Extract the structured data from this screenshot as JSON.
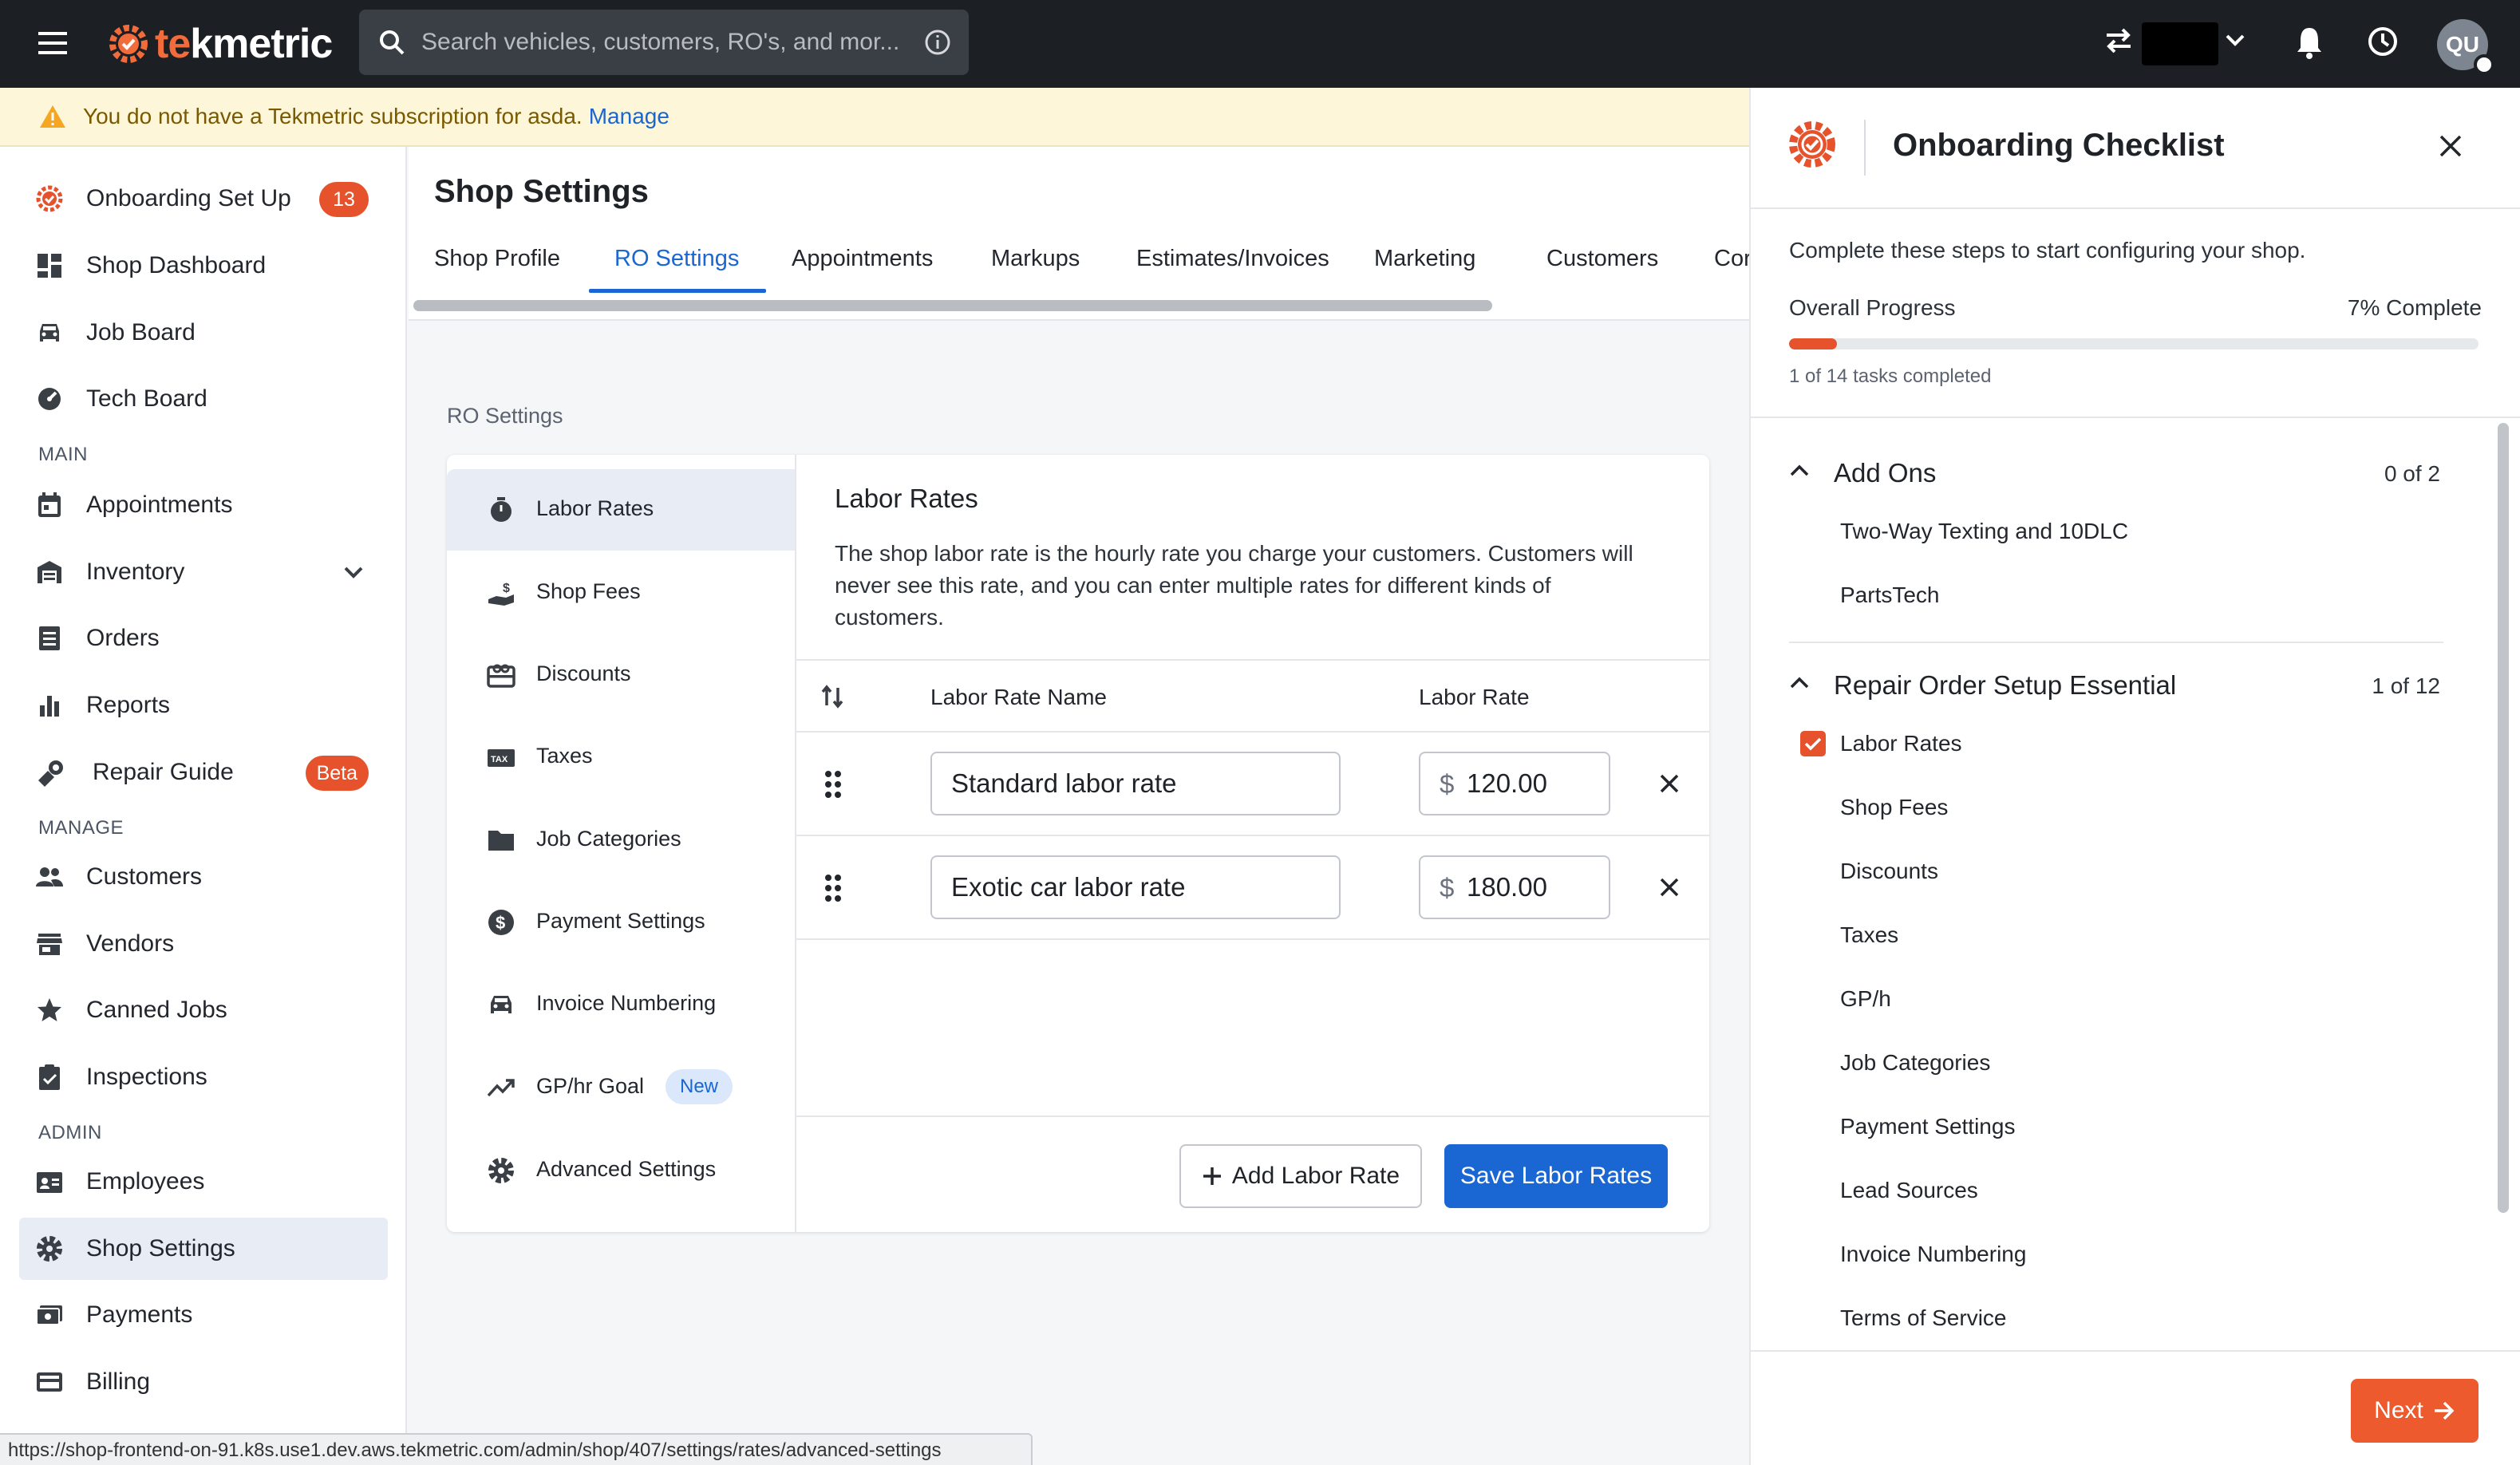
{
  "topbar": {
    "logo_text_accent": "te",
    "logo_text_rest": "kmetric",
    "search_placeholder": "Search vehicles, customers, RO's, and mor...",
    "avatar_initials": "QU",
    "icons": [
      "menu-icon",
      "search-icon",
      "info-icon",
      "swap-icon",
      "chevron-down-icon",
      "bell-icon",
      "clock-icon"
    ]
  },
  "banner": {
    "message": "You do not have a Tekmetric subscription for asda.",
    "link": "Manage"
  },
  "sidebar": {
    "items_top": [
      {
        "label": "Onboarding Set Up",
        "badge": "13",
        "icon": "gear-check-icon"
      },
      {
        "label": "Shop Dashboard",
        "icon": "dashboard-icon"
      },
      {
        "label": "Job Board",
        "icon": "car-icon"
      },
      {
        "label": "Tech Board",
        "icon": "speed-icon"
      }
    ],
    "section_main": "MAIN",
    "items_main": [
      {
        "label": "Appointments",
        "icon": "calendar-icon"
      },
      {
        "label": "Inventory",
        "icon": "warehouse-icon"
      },
      {
        "label": "Orders",
        "icon": "list-icon"
      },
      {
        "label": "Reports",
        "icon": "bar-chart-icon"
      },
      {
        "label": "Repair Guide",
        "badge": "Beta",
        "icon": "repair-guide-icon"
      }
    ],
    "section_manage": "MANAGE",
    "items_manage": [
      {
        "label": "Customers",
        "icon": "people-icon"
      },
      {
        "label": "Vendors",
        "icon": "store-icon"
      },
      {
        "label": "Canned Jobs",
        "icon": "star-icon"
      },
      {
        "label": "Inspections",
        "icon": "clipboard-icon"
      }
    ],
    "section_admin": "ADMIN",
    "items_admin": [
      {
        "label": "Employees",
        "icon": "badge-icon"
      },
      {
        "label": "Shop Settings",
        "icon": "gear-icon",
        "active": true
      },
      {
        "label": "Payments",
        "icon": "money-icon"
      },
      {
        "label": "Billing",
        "icon": "card-icon"
      }
    ]
  },
  "status_url": "https://shop-frontend-on-91.k8s.use1.dev.aws.tekmetric.com/admin/shop/407/settings/rates/advanced-settings",
  "main": {
    "title": "Shop Settings",
    "tabs": [
      "Shop Profile",
      "RO Settings",
      "Appointments",
      "Markups",
      "Estimates/Invoices",
      "Marketing",
      "Customers",
      "Cor"
    ],
    "active_tab": "RO Settings",
    "breadcrumb": "RO Settings",
    "subnav": [
      {
        "label": "Labor Rates",
        "icon": "timer-icon",
        "active": true
      },
      {
        "label": "Shop Fees",
        "icon": "fee-icon"
      },
      {
        "label": "Discounts",
        "icon": "gift-card-icon"
      },
      {
        "label": "Taxes",
        "icon": "tax-icon"
      },
      {
        "label": "Job Categories",
        "icon": "folder-icon"
      },
      {
        "label": "Payment Settings",
        "icon": "dollar-circle-icon"
      },
      {
        "label": "Invoice Numbering",
        "icon": "car-icon"
      },
      {
        "label": "GP/hr Goal",
        "icon": "trending-up-icon",
        "pill": "New"
      },
      {
        "label": "Advanced Settings",
        "icon": "gear-icon"
      }
    ],
    "panel": {
      "title": "Labor Rates",
      "description": "The shop labor rate is the hourly rate you charge your customers. Customers will never see this rate, and you can enter multiple rates for different kinds of customers.",
      "col_name": "Labor Rate Name",
      "col_rate": "Labor Rate",
      "currency": "$",
      "rows": [
        {
          "name": "Standard labor rate",
          "rate": "120.00"
        },
        {
          "name": "Exotic car labor rate",
          "rate": "180.00"
        }
      ],
      "add_button": "Add Labor Rate",
      "save_button": "Save Labor Rates"
    }
  },
  "drawer": {
    "title": "Onboarding Checklist",
    "intro": "Complete these steps to start configuring your shop.",
    "progress_label": "Overall Progress",
    "progress_pct_text": "7% Complete",
    "progress_fraction": 0.07,
    "tasks_completed": "1 of 14 tasks completed",
    "groups": [
      {
        "title": "Add Ons",
        "count": "0 of 2",
        "tasks": [
          {
            "label": "Two-Way Texting and 10DLC",
            "done": false
          },
          {
            "label": "PartsTech",
            "done": false
          }
        ]
      },
      {
        "title": "Repair Order Setup Essential",
        "count": "1 of 12",
        "tasks": [
          {
            "label": "Labor Rates",
            "done": true
          },
          {
            "label": "Shop Fees",
            "done": false
          },
          {
            "label": "Discounts",
            "done": false
          },
          {
            "label": "Taxes",
            "done": false
          },
          {
            "label": "GP/h",
            "done": false
          },
          {
            "label": "Job Categories",
            "done": false
          },
          {
            "label": "Payment Settings",
            "done": false
          },
          {
            "label": "Lead Sources",
            "done": false
          },
          {
            "label": "Invoice Numbering",
            "done": false
          },
          {
            "label": "Terms of Service",
            "done": false
          }
        ]
      }
    ],
    "next_button": "Next"
  },
  "colors": {
    "brand_orange": "#e6522c",
    "primary_blue": "#1a66d2",
    "topbar_bg": "#1c1f24",
    "banner_bg": "#fdf6d8"
  }
}
